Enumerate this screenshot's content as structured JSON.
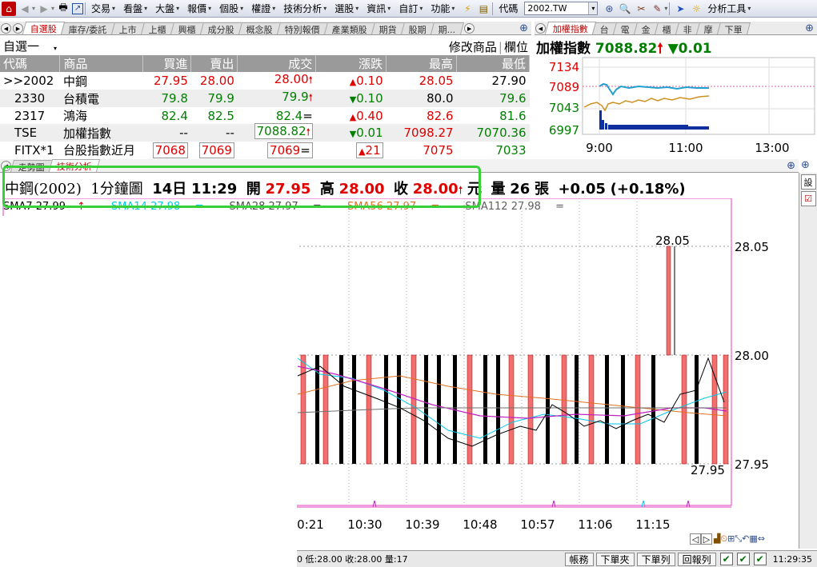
{
  "toolbar": {
    "menus": [
      {
        "label": "交易"
      },
      {
        "label": "看盤"
      },
      {
        "label": "大盤"
      },
      {
        "label": "報價"
      },
      {
        "label": "個股"
      },
      {
        "label": "權證"
      },
      {
        "label": "技術分析"
      },
      {
        "label": "選股"
      },
      {
        "label": "資訊"
      },
      {
        "label": "自訂"
      },
      {
        "label": "功能"
      }
    ],
    "code_label": "代碼",
    "code_value": "2002.TW",
    "analysis_tools": "分析工具"
  },
  "top_tabs": [
    "自選股",
    "庫存/委託",
    "上市",
    "上櫃",
    "興櫃",
    "成分股",
    "概念股",
    "特別報價",
    "產業類股",
    "期貨",
    "股期",
    "期..."
  ],
  "watchlist": {
    "title": "自選一",
    "modify": "修改商品",
    "columns_btn": "欄位",
    "headers": [
      "代碼",
      "商品",
      "買進",
      "賣出",
      "成交",
      "漲跌",
      "最高",
      "最低"
    ],
    "rows": [
      {
        "code": ">>2002",
        "name": "中鋼",
        "bid": "27.95",
        "ask": "28.00",
        "last": "28.00",
        "chg": "0.10",
        "high": "28.05",
        "low": "27.90"
      },
      {
        "code": "2330",
        "name": "台積電",
        "bid": "79.8",
        "ask": "79.9",
        "last": "79.9",
        "chg": "0.10",
        "high": "80.0",
        "low": "79.6"
      },
      {
        "code": "2317",
        "name": "鴻海",
        "bid": "82.4",
        "ask": "82.5",
        "last": "82.4",
        "chg": "0.40",
        "high": "82.6",
        "low": "81.6"
      },
      {
        "code": "TSE",
        "name": "加權指數",
        "bid": "--",
        "ask": "--",
        "last": "7088.82",
        "chg": "0.01",
        "high": "7098.27",
        "low": "7070.36"
      },
      {
        "code": "FITX*1",
        "name": "台股指數近月",
        "bid": "7068",
        "ask": "7069",
        "last": "7069",
        "chg": "21",
        "high": "7075",
        "low": "7033"
      }
    ]
  },
  "index_tabs": [
    "加權指數",
    "台",
    "電",
    "金",
    "櫃",
    "非",
    "摩",
    "下單"
  ],
  "index_panel": {
    "name": "加權指數",
    "value": "7088.82",
    "change": "0.01",
    "y_ticks": [
      "7134",
      "7089",
      "7043",
      "6997"
    ],
    "x_ticks": [
      "9:00",
      "11:00",
      "13:00"
    ]
  },
  "chart_tabs": [
    "走勢圖",
    "技術分析"
  ],
  "chart_info": {
    "title": "中鋼(2002)",
    "period": "1分鐘圖",
    "day": "14日",
    "time": "11:29",
    "open_label": "開",
    "open": "27.95",
    "high_label": "高",
    "high": "28.00",
    "close_label": "收",
    "close": "28.00",
    "unit": "元",
    "vol_label": "量",
    "vol": "26",
    "vol_unit": "張",
    "change": "+0.05",
    "change_pct": "(+0.18%)"
  },
  "sma": [
    {
      "label": "SMA7 27.99",
      "mark": "↑",
      "color": "#000000"
    },
    {
      "label": "SMA14 27.98",
      "mark": "=",
      "color": "#00c8e8"
    },
    {
      "label": "SMA28 27.97",
      "mark": "=",
      "color": "#505050"
    },
    {
      "label": "SMA56 27.97",
      "mark": "=",
      "color": "#e07020"
    },
    {
      "label": "SMA112 27.98",
      "mark": "=",
      "color": "#606060"
    }
  ],
  "chart_data": {
    "type": "bar",
    "y_ticks": [
      "28.05",
      "28.00",
      "27.95"
    ],
    "x_ticks": [
      "0:21",
      "10:30",
      "10:39",
      "10:48",
      "10:57",
      "11:06",
      "11:15"
    ],
    "annotations": [
      "28.05",
      "27.95"
    ],
    "ylim": [
      27.95,
      28.05
    ]
  },
  "status": {
    "text": "0 低:28.00 收:28.00 量:17",
    "buttons": [
      "帳務",
      "下單夾",
      "下單列",
      "回報列"
    ],
    "time": "11:29:35"
  },
  "colors": {
    "up": "#e00000",
    "down": "#008000",
    "highlight": "#38d038"
  }
}
